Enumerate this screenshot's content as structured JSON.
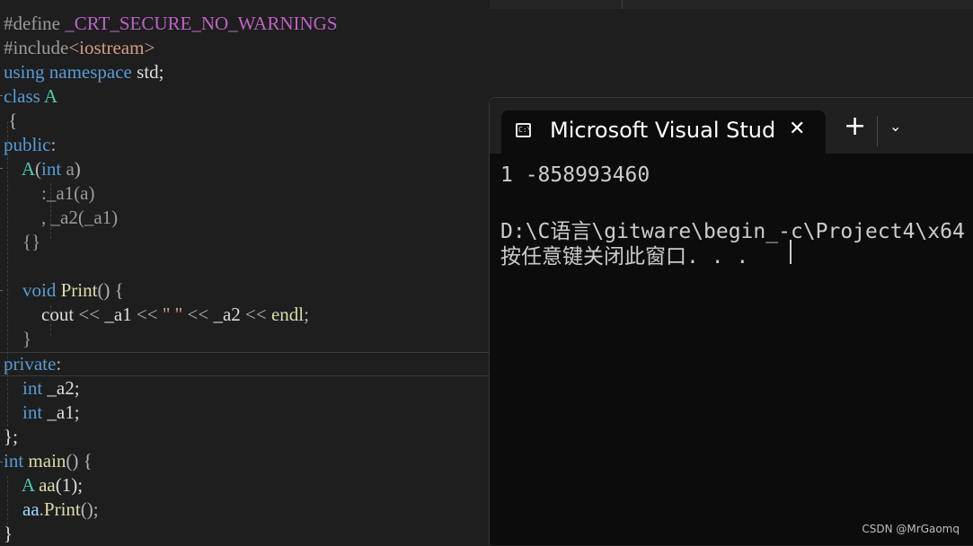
{
  "editor": {
    "lines": {
      "l1_define": "#define",
      "l1_macro": "_CRT_SECURE_NO_WARNINGS",
      "l2_include": "#include",
      "l2_header": "<iostream>",
      "l3_using": "using",
      "l3_namespace": "namespace",
      "l3_std": "std;",
      "l4_class": "class",
      "l4_name": "A",
      "l5": "{",
      "l6_public": "public",
      "l6_colon": ":",
      "l7_ctor": "A",
      "l7_open": "(",
      "l7_int": "int",
      "l7_param": "a",
      "l7_close": ")",
      "l8_text": ":_a1(a)",
      "l9_text": ", _a2(_a1)",
      "l10": "{}",
      "l12_void": "void",
      "l12_fn": "Print",
      "l12_rest": "() {",
      "l13_cout": "cout",
      "l13_op1": " << ",
      "l13_a1": "_a1",
      "l13_op2": " << ",
      "l13_str": "\" \"",
      "l13_op3": " << ",
      "l13_a2": "_a2",
      "l13_op4": " << ",
      "l13_endl": "endl",
      "l13_semi": ";",
      "l14": "}",
      "l15_private": "private",
      "l15_colon": ":",
      "l16_int": "int",
      "l16_var": " _a2;",
      "l17_int": "int",
      "l17_var": " _a1;",
      "l18": "};",
      "l19_int": "int",
      "l19_main": "main",
      "l19_rest": "() {",
      "l20_type": "A",
      "l20_var": "aa",
      "l20_rest": "(1);",
      "l21_var": "aa",
      "l21_dot": ".",
      "l21_fn": "Print",
      "l21_rest": "();",
      "l22": "}"
    }
  },
  "console": {
    "tab_title": "Microsoft Visual Stud",
    "tab_icon": "console-app-icon",
    "tab_icon_text": "C:\\",
    "close_glyph": "✕",
    "new_tab_glyph": "+",
    "dropdown_glyph": "⌄",
    "output_line1": "1 -858993460",
    "output_line2": "D:\\C语言\\gitware\\begin_-c\\Project4\\x64",
    "output_line3": "按任意键关闭此窗口. . ."
  },
  "watermark": "CSDN @MrGaomq",
  "colors": {
    "editor_bg": "#1e1e1e",
    "keyword": "#569cd6",
    "type": "#4ec9b0",
    "function": "#dcdcaa",
    "variable": "#9cdcfe",
    "macro": "#bd63c5",
    "string": "#d69d85",
    "console_bg": "#0c0c0c",
    "tabbar_bg": "#202020"
  }
}
